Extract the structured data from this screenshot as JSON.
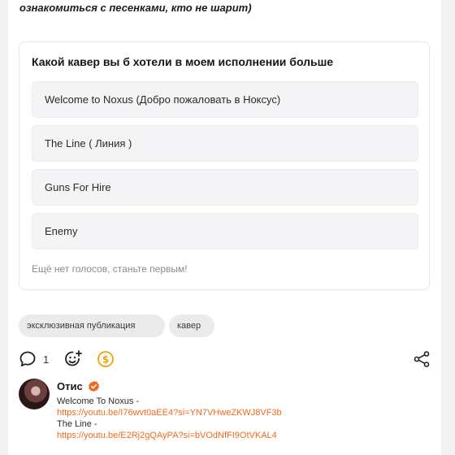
{
  "post": {
    "intro_text": "ознакомиться с песенками, кто не шарит)"
  },
  "poll": {
    "question": "Какой кавер вы б хотели в моем исполнении больше",
    "options": [
      {
        "label": "Welcome to Noxus (Добро пожаловать в Ноксус)"
      },
      {
        "label": "The Line ( Линия )"
      },
      {
        "label": "Guns For Hire"
      },
      {
        "label": "Enemy"
      }
    ],
    "empty_state": "Ещё нет голосов, станьте первым!"
  },
  "tags": [
    "эксклюзивная публикация",
    "кавер"
  ],
  "actions": {
    "comment_count": "1",
    "icons": [
      "comment-icon",
      "add-reaction-icon",
      "dollar-coin-icon",
      "share-icon"
    ]
  },
  "comment": {
    "author": "Отис",
    "lines": [
      {
        "text": "Welcome To Noxus -",
        "kind": "text"
      },
      {
        "text": "https://youtu.be/I76wvt0aEE4?si=YN7VHweZKWJ8VF3b",
        "kind": "link"
      },
      {
        "text": "The Line -",
        "kind": "text"
      },
      {
        "text": "https://youtu.be/E2Rj2gQAyPA?si=bVOdNfFI9OtVKAL4",
        "kind": "link"
      }
    ]
  },
  "colors": {
    "accent": "#f06a1c",
    "coin": "#f2a20c",
    "page_bg": "#f2f2f3"
  }
}
